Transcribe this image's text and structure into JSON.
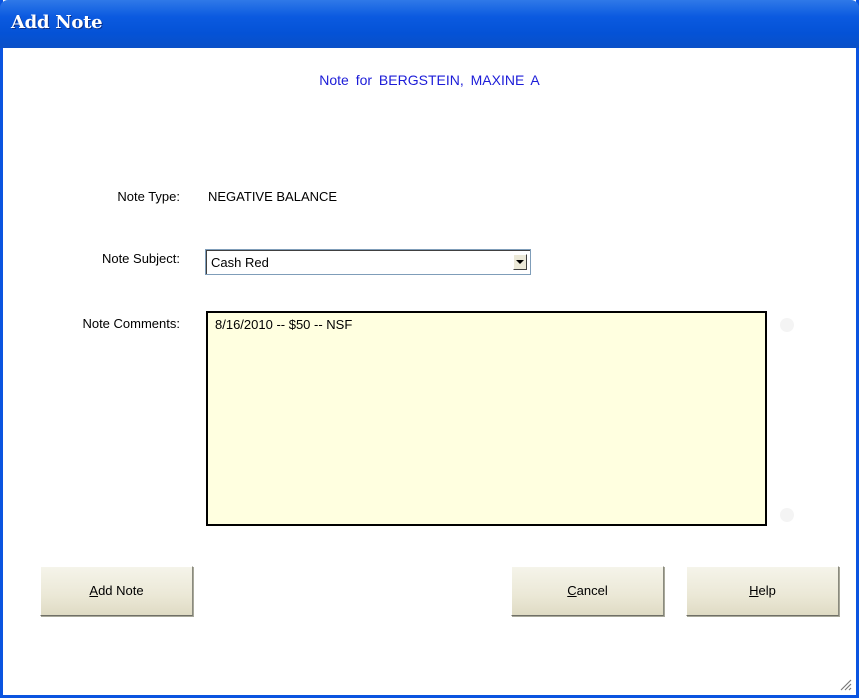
{
  "window": {
    "title": "Add Note"
  },
  "subtitle": "Note for BERGSTEIN, MAXINE A",
  "form": {
    "note_type_label": "Note Type:",
    "note_type_value": "NEGATIVE BALANCE",
    "note_subject_label": "Note Subject:",
    "note_subject_value": "Cash Red",
    "note_comments_label": "Note Comments:",
    "note_comments_value": "8/16/2010 -- $50 -- NSF"
  },
  "buttons": {
    "add_note": {
      "prefix": "",
      "mnemonic": "A",
      "rest": "dd Note"
    },
    "cancel": {
      "prefix": "",
      "mnemonic": "C",
      "rest": "ancel"
    },
    "help": {
      "prefix": "",
      "mnemonic": "H",
      "rest": "elp"
    }
  },
  "icons": {
    "dropdown": "chevron-down-icon",
    "resize": "resize-grip-icon"
  },
  "colors": {
    "titlebar": "#0b5ae0",
    "subtitle_text": "#1c1cd8",
    "comments_background": "#ffffe0",
    "button_face": "#ece9d8"
  }
}
